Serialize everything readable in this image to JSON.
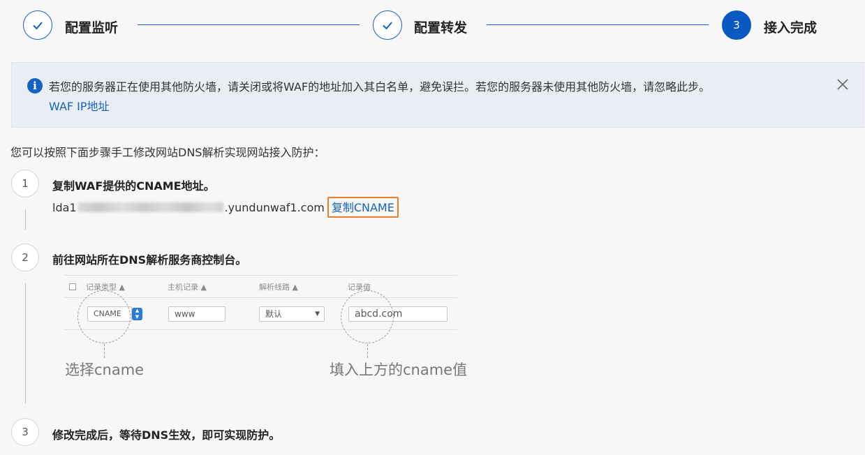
{
  "stepper": {
    "steps": [
      {
        "label": "配置监听",
        "state": "done"
      },
      {
        "label": "配置转发",
        "state": "done"
      },
      {
        "label": "接入完成",
        "state": "active",
        "number": "3"
      }
    ],
    "accent": "#0a59c2"
  },
  "alert": {
    "icon": "info-icon",
    "text": "若您的服务器正在使用其他防火墙，请关闭或将WAF的地址加入其白名单，避免误拦。若您的服务器未使用其他防火墙，请忽略此步。",
    "link": "WAF IP地址"
  },
  "intro": "您可以按照下面步骤手工修改网站DNS解析实现网站接入防护：",
  "steps": [
    {
      "number": "1",
      "title": "复制WAF提供的CNAME地址。",
      "cname_prefix": "lda1",
      "cname_suffix": ".yundunwaf1.com",
      "copy_label": "复制CNAME"
    },
    {
      "number": "2",
      "title": "前往网站所在DNS解析服务商控制台。",
      "illustration": {
        "headers": [
          "记录类型 ▲",
          "主机记录 ▲",
          "解析线路 ▲",
          "记录值"
        ],
        "record_type": "CNAME",
        "host": "www",
        "line": "默认",
        "value": "abcd.com",
        "caption_left": "选择cname",
        "caption_right": "填入上方的cname值"
      }
    },
    {
      "number": "3",
      "title": "修改完成后，等待DNS生效，即可实现防护。"
    }
  ]
}
